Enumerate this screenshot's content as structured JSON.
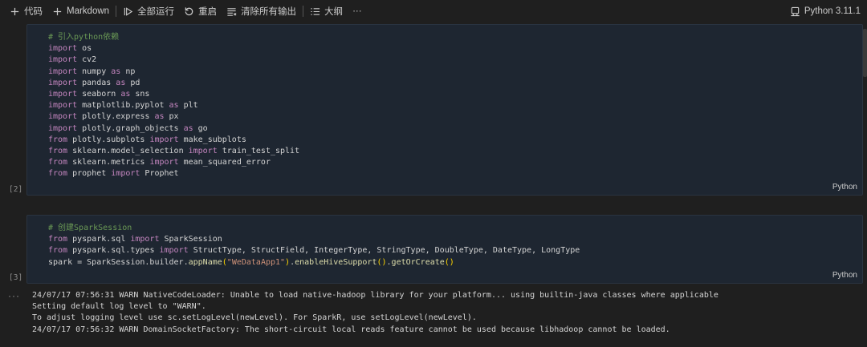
{
  "toolbar": {
    "add_code": "代码",
    "add_markdown": "Markdown",
    "run_all": "全部运行",
    "restart": "重启",
    "clear_outputs": "清除所有输出",
    "outline": "大纲",
    "more": "···",
    "kernel": "Python 3.11.1"
  },
  "cells": [
    {
      "exec_count": "[2]",
      "language": "Python",
      "lines": [
        [
          {
            "t": "# 引入python依赖",
            "c": "cm"
          }
        ],
        [
          {
            "t": "import",
            "c": "kw"
          },
          {
            "t": " os"
          }
        ],
        [
          {
            "t": "import",
            "c": "kw"
          },
          {
            "t": " cv2"
          }
        ],
        [
          {
            "t": "import",
            "c": "kw"
          },
          {
            "t": " numpy "
          },
          {
            "t": "as",
            "c": "kw"
          },
          {
            "t": " np"
          }
        ],
        [
          {
            "t": "import",
            "c": "kw"
          },
          {
            "t": " pandas "
          },
          {
            "t": "as",
            "c": "kw"
          },
          {
            "t": " pd"
          }
        ],
        [
          {
            "t": "import",
            "c": "kw"
          },
          {
            "t": " seaborn "
          },
          {
            "t": "as",
            "c": "kw"
          },
          {
            "t": " sns"
          }
        ],
        [
          {
            "t": "import",
            "c": "kw"
          },
          {
            "t": " matplotlib.pyplot "
          },
          {
            "t": "as",
            "c": "kw"
          },
          {
            "t": " plt"
          }
        ],
        [
          {
            "t": "import",
            "c": "kw"
          },
          {
            "t": " plotly.express "
          },
          {
            "t": "as",
            "c": "kw"
          },
          {
            "t": " px"
          }
        ],
        [
          {
            "t": "import",
            "c": "kw"
          },
          {
            "t": " plotly.graph_objects "
          },
          {
            "t": "as",
            "c": "kw"
          },
          {
            "t": " go"
          }
        ],
        [
          {
            "t": "from",
            "c": "kw"
          },
          {
            "t": " plotly.subplots "
          },
          {
            "t": "import",
            "c": "kw"
          },
          {
            "t": " make_subplots"
          }
        ],
        [
          {
            "t": "from",
            "c": "kw"
          },
          {
            "t": " sklearn.model_selection "
          },
          {
            "t": "import",
            "c": "kw"
          },
          {
            "t": " train_test_split"
          }
        ],
        [
          {
            "t": "from",
            "c": "kw"
          },
          {
            "t": " sklearn.metrics "
          },
          {
            "t": "import",
            "c": "kw"
          },
          {
            "t": " mean_squared_error"
          }
        ],
        [
          {
            "t": "from",
            "c": "kw"
          },
          {
            "t": " prophet "
          },
          {
            "t": "import",
            "c": "kw"
          },
          {
            "t": " Prophet"
          }
        ]
      ]
    },
    {
      "exec_count": "[3]",
      "language": "Python",
      "lines": [
        [
          {
            "t": "# 创建SparkSession",
            "c": "cm"
          }
        ],
        [
          {
            "t": "from",
            "c": "kw"
          },
          {
            "t": " pyspark.sql "
          },
          {
            "t": "import",
            "c": "kw"
          },
          {
            "t": " SparkSession"
          }
        ],
        [
          {
            "t": "from",
            "c": "kw"
          },
          {
            "t": " pyspark.sql.types "
          },
          {
            "t": "import",
            "c": "kw"
          },
          {
            "t": " StructType, StructField, IntegerType, StringType, DoubleType, DateType, LongType"
          }
        ],
        [
          {
            "t": "spark = SparkSession.builder."
          },
          {
            "t": "appName",
            "c": "fn"
          },
          {
            "t": "(",
            "c": "br"
          },
          {
            "t": "\"WeDataApp1\"",
            "c": "st"
          },
          {
            "t": ")",
            "c": "br"
          },
          {
            "t": "."
          },
          {
            "t": "enableHiveSupport",
            "c": "fn"
          },
          {
            "t": "()",
            "c": "br"
          },
          {
            "t": "."
          },
          {
            "t": "getOrCreate",
            "c": "fn"
          },
          {
            "t": "()",
            "c": "br"
          }
        ]
      ]
    }
  ],
  "output": {
    "dots": "···",
    "lines": [
      "24/07/17 07:56:31 WARN NativeCodeLoader: Unable to load native-hadoop library for your platform... using builtin-java classes where applicable",
      "Setting default log level to \"WARN\".",
      "To adjust logging level use sc.setLogLevel(newLevel). For SparkR, use setLogLevel(newLevel).",
      "24/07/17 07:56:32 WARN DomainSocketFactory: The short-circuit local reads feature cannot be used because libhadoop cannot be loaded."
    ]
  }
}
